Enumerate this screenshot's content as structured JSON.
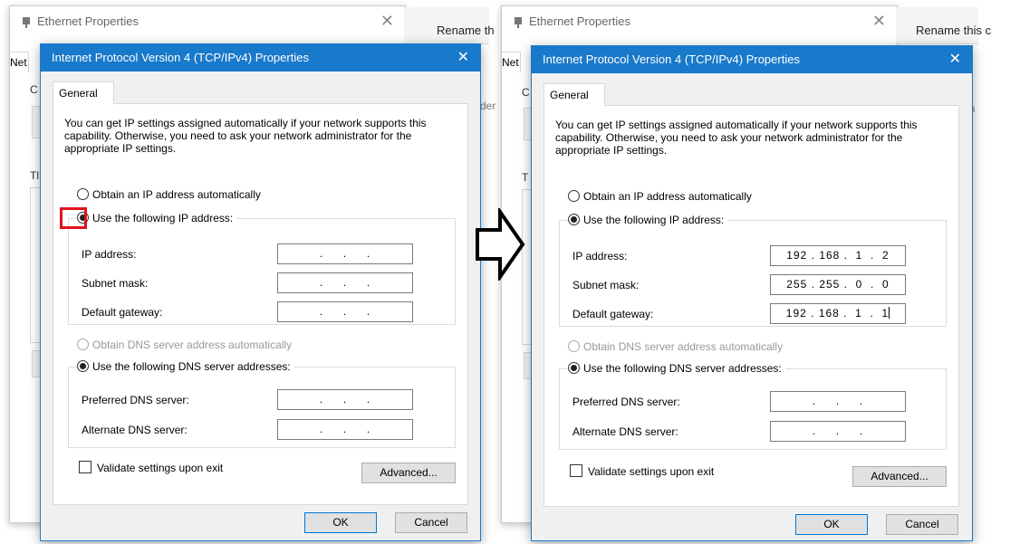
{
  "panels": [
    {
      "background_window": {
        "title": "Ethernet Properties",
        "close_glyph": "✕",
        "tab_fragment": "Net",
        "rename_text": "Rename th",
        "side_text": "der",
        "frag_c": "C",
        "frag_t": "Tl"
      },
      "dialog": {
        "title": "Internet Protocol Version 4 (TCP/IPv4) Properties",
        "close_glyph": "✕",
        "tab": "General",
        "intro": "You can get IP settings assigned automatically if your network supports this capability. Otherwise, you need to ask your network administrator for the appropriate IP settings.",
        "obtain_ip_auto": "Obtain an IP address automatically",
        "use_following_ip": "Use the following IP address:",
        "ip_label": "IP address:",
        "subnet_label": "Subnet mask:",
        "gateway_label": "Default gateway:",
        "ip_value": ".     .     .",
        "subnet_value": ".     .     .",
        "gateway_value": ".     .     .",
        "obtain_dns_auto": "Obtain DNS server address automatically",
        "use_following_dns": "Use the following DNS server addresses:",
        "preferred_dns_label": "Preferred DNS server:",
        "alternate_dns_label": "Alternate DNS server:",
        "preferred_dns_value": ".     .     .",
        "alternate_dns_value": ".     .     .",
        "validate_label": "Validate settings upon exit",
        "advanced_button": "Advanced...",
        "ok_button": "OK",
        "cancel_button": "Cancel"
      }
    },
    {
      "background_window": {
        "title": "Ethernet Properties",
        "close_glyph": "✕",
        "tab_fragment": "Net",
        "rename_text": "Rename this c",
        "side_text": "dem",
        "frag_c": "C",
        "frag_t": "T"
      },
      "dialog": {
        "title": "Internet Protocol Version 4 (TCP/IPv4) Properties",
        "close_glyph": "✕",
        "tab": "General",
        "intro": "You can get IP settings assigned automatically if your network supports this capability. Otherwise, you need to ask your network administrator for the appropriate IP settings.",
        "obtain_ip_auto": "Obtain an IP address automatically",
        "use_following_ip": "Use the following IP address:",
        "ip_label": "IP address:",
        "subnet_label": "Subnet mask:",
        "gateway_label": "Default gateway:",
        "ip_value": "192 . 168 .  1  .  2",
        "subnet_value": "255 . 255 .  0  .  0",
        "gateway_value": "192 . 168 .  1  .  1",
        "obtain_dns_auto": "Obtain DNS server address automatically",
        "use_following_dns": "Use the following DNS server addresses:",
        "preferred_dns_label": "Preferred DNS server:",
        "alternate_dns_label": "Alternate DNS server:",
        "preferred_dns_value": ".     .     .",
        "alternate_dns_value": ".     .     .",
        "validate_label": "Validate settings upon exit",
        "advanced_button": "Advanced...",
        "ok_button": "OK",
        "cancel_button": "Cancel"
      }
    }
  ],
  "icons": {
    "network_adapter": "network-adapter-icon",
    "flow_arrow": "right-arrow-icon",
    "highlight": "red-highlight-box"
  },
  "colors": {
    "title_bar": "#1979ca",
    "highlight": "#e0141e"
  }
}
